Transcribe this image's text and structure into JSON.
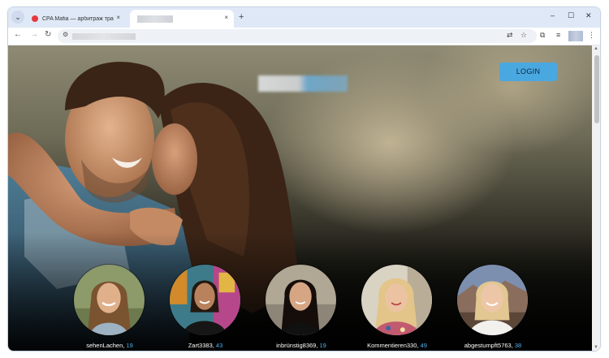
{
  "browser": {
    "tabs": [
      {
        "title": "CPA Mafia — арбитраж трафика",
        "favicon_color": "#e5393c"
      },
      {
        "title": ""
      }
    ],
    "new_tab_label": "+",
    "tab_close_glyph": "×",
    "window_controls": {
      "minimize": "–",
      "maximize": "☐",
      "close": "✕"
    }
  },
  "toolbar": {
    "back": "←",
    "forward": "→",
    "reload": "↻",
    "address": ""
  },
  "page": {
    "login_label": "LOGIN",
    "accent_color": "#4aa8e0",
    "profiles": [
      {
        "name": "sehenLachen",
        "count": "19"
      },
      {
        "name": "Zart3383",
        "count": "43"
      },
      {
        "name": "inbrünstig8369",
        "count": "19"
      },
      {
        "name": "Kommentieren330",
        "count": "49"
      },
      {
        "name": "abgestumpft5763",
        "count": "38"
      }
    ]
  }
}
